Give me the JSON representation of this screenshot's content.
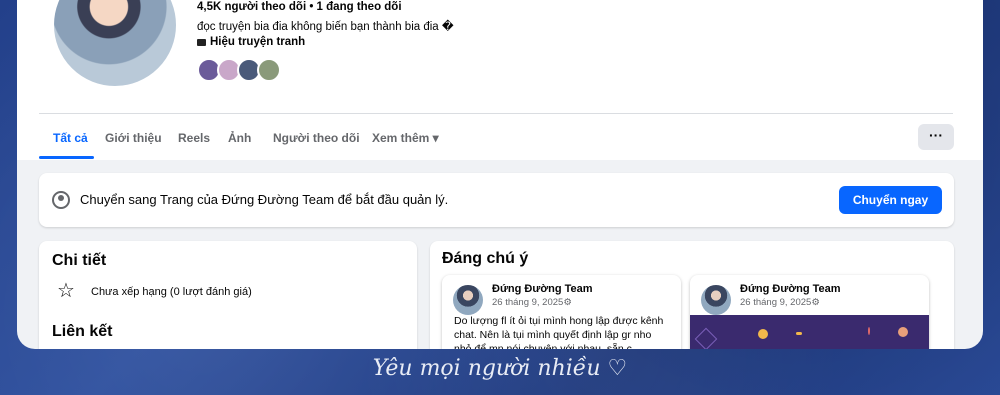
{
  "profile": {
    "followers_line": "4,5K người theo dõi • 1 đang theo dõi",
    "bio": "đọc truyện bia đia không biến bạn thành bia đia �",
    "category": "Hiệu truyện tranh",
    "friend_colors": [
      "#6b5b9a",
      "#c9a7c9",
      "#4a5a7a",
      "#8a9a7a"
    ]
  },
  "tabs": [
    {
      "label": "Tất cả"
    },
    {
      "label": "Giới thiệu"
    },
    {
      "label": "Reels"
    },
    {
      "label": "Ảnh"
    },
    {
      "label": "Người theo dõi"
    },
    {
      "label": "Xem thêm ▾"
    }
  ],
  "more_button": "···",
  "switch_banner": {
    "text": "Chuyển sang Trang của Đứng Đường Team để bắt đầu quản lý.",
    "button": "Chuyển ngay"
  },
  "details": {
    "title": "Chi tiết",
    "rating": "Chưa xếp hạng (0 lượt đánh giá)",
    "links_title": "Liên kết"
  },
  "featured": {
    "title": "Đáng chú ý",
    "posts": [
      {
        "author": "Đứng Đường Team",
        "date": "26 tháng 9, 2025⚙",
        "text": "Do lượng fl ít ỏi tụi mình hong lập được kênh chat. Nên là tụi mình quyết định lập gr nho nhỏ để mn nói chuyện với nhau, sẵn c"
      },
      {
        "author": "Đứng Đường Team",
        "date": "26 tháng 9, 2025⚙"
      }
    ]
  },
  "caption": "Yêu mọi người nhiều ♡",
  "colors": {
    "accent": "#0866ff",
    "background": "#f0f2f5",
    "frame_bg": "#23408a"
  }
}
